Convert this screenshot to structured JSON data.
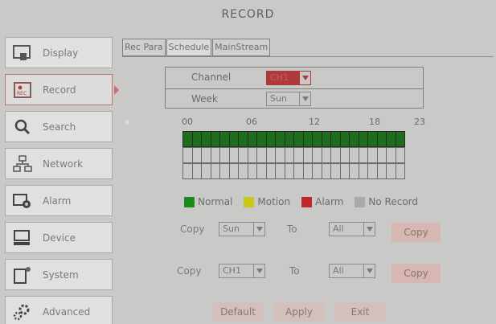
{
  "window": {
    "title": "RECORD"
  },
  "sidebar": {
    "items": [
      {
        "label": "Display",
        "icon": "display-icon",
        "active": false
      },
      {
        "label": "Record",
        "icon": "record-icon",
        "active": true
      },
      {
        "label": "Search",
        "icon": "search-icon",
        "active": false
      },
      {
        "label": "Network",
        "icon": "network-icon",
        "active": false
      },
      {
        "label": "Alarm",
        "icon": "alarm-icon",
        "active": false
      },
      {
        "label": "Device",
        "icon": "device-icon",
        "active": false
      },
      {
        "label": "System",
        "icon": "system-icon",
        "active": false
      },
      {
        "label": "Advanced",
        "icon": "advanced-icon",
        "active": false
      }
    ]
  },
  "tabs": [
    {
      "label": "Rec Para",
      "active": false
    },
    {
      "label": "Schedule",
      "active": true
    },
    {
      "label": "MainStream",
      "active": false
    }
  ],
  "schedule": {
    "channel_label": "Channel",
    "channel_value": "CH1",
    "week_label": "Week",
    "week_value": "Sun",
    "hour_labels": [
      "00",
      "06",
      "12",
      "18",
      "23"
    ],
    "rows": [
      [
        "normal",
        "normal",
        "normal",
        "normal",
        "normal",
        "normal",
        "normal",
        "normal",
        "normal",
        "normal",
        "normal",
        "normal",
        "normal",
        "normal",
        "normal",
        "normal",
        "normal",
        "normal",
        "normal",
        "normal",
        "normal",
        "normal",
        "normal",
        "normal"
      ],
      [
        "none",
        "none",
        "none",
        "none",
        "none",
        "none",
        "none",
        "none",
        "none",
        "none",
        "none",
        "none",
        "none",
        "none",
        "none",
        "none",
        "none",
        "none",
        "none",
        "none",
        "none",
        "none",
        "none",
        "none"
      ],
      [
        "none",
        "none",
        "none",
        "none",
        "none",
        "none",
        "none",
        "none",
        "none",
        "none",
        "none",
        "none",
        "none",
        "none",
        "none",
        "none",
        "none",
        "none",
        "none",
        "none",
        "none",
        "none",
        "none",
        "none"
      ]
    ]
  },
  "legend": [
    {
      "label": "Normal",
      "color": "#1e8a1e"
    },
    {
      "label": "Motion",
      "color": "#c8c81a"
    },
    {
      "label": "Alarm",
      "color": "#c02828"
    },
    {
      "label": "No Record",
      "color": "#a9a9a7"
    }
  ],
  "copy_day": {
    "copy_label": "Copy",
    "from_value": "Sun",
    "to_label": "To",
    "to_value": "All",
    "button": "Copy"
  },
  "copy_channel": {
    "copy_label": "Copy",
    "from_value": "CH1",
    "to_label": "To",
    "to_value": "All",
    "button": "Copy"
  },
  "footer": {
    "default_button": "Default",
    "apply_button": "Apply",
    "exit_button": "Exit"
  },
  "colors": {
    "accent_red": "#b03a3a",
    "record_green": "#1e6d1e",
    "button_bg": "#d6b7b2"
  }
}
